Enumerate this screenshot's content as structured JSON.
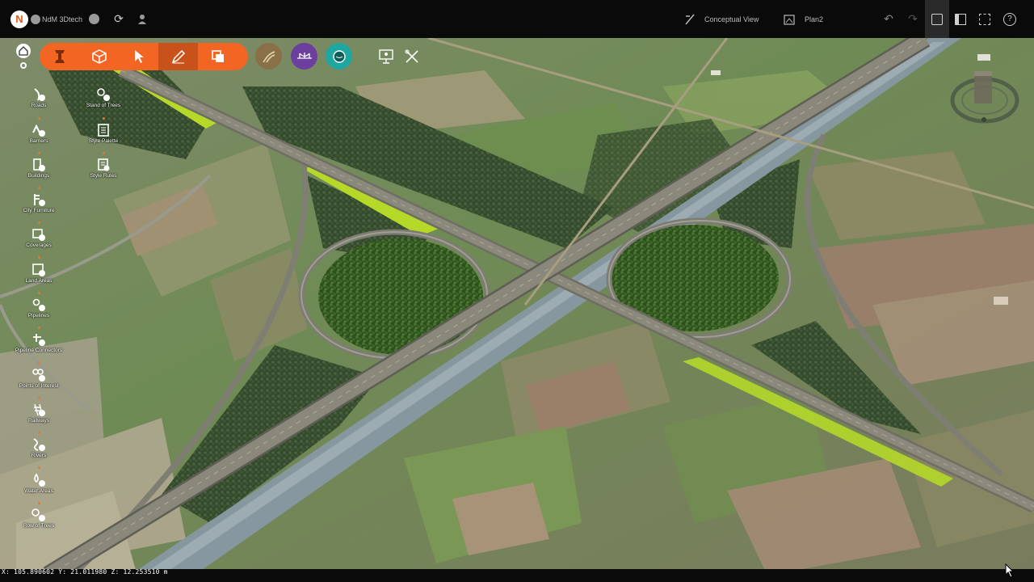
{
  "app": {
    "logo_letter": "N",
    "project_name": "NdM 3Dtech"
  },
  "topbar": {
    "view_mode": "Conceptual View",
    "plan_name": "Plan2",
    "icons": [
      "status-icon",
      "sync-icon",
      "user-icon",
      "view-icon",
      "plan-icon",
      "undo-icon",
      "redo-icon",
      "screenshot-icon",
      "panel-icon",
      "fullscreen-icon",
      "help-icon"
    ]
  },
  "toolbar": {
    "orange_tools": [
      "road-tool-icon",
      "cube-tool-icon",
      "select-tool-icon",
      "draw-tool-icon",
      "layers-tool-icon"
    ],
    "active_tool": "draw-tool-icon",
    "circle_tools": [
      {
        "name": "terrain-tool",
        "color": "#8a7048"
      },
      {
        "name": "bridge-tool",
        "color": "#6c3e9e"
      },
      {
        "name": "water-tool",
        "color": "#1da7a0"
      }
    ],
    "extra_tools": [
      "presentation-icon",
      "tools-icon"
    ]
  },
  "sidebar": {
    "left": [
      {
        "label": "Roads",
        "icon": "roads-icon"
      },
      {
        "label": "Barriers",
        "icon": "barriers-icon"
      },
      {
        "label": "Buildings",
        "icon": "buildings-icon"
      },
      {
        "label": "City Furniture",
        "icon": "city-furniture-icon"
      },
      {
        "label": "Coverages",
        "icon": "coverages-icon"
      },
      {
        "label": "Land Areas",
        "icon": "land-areas-icon"
      },
      {
        "label": "Pipelines",
        "icon": "pipelines-icon"
      },
      {
        "label": "Pipeline Connectors",
        "icon": "pipeline-connectors-icon"
      },
      {
        "label": "Points of Interest",
        "icon": "points-of-interest-icon"
      },
      {
        "label": "Railways",
        "icon": "railways-icon"
      },
      {
        "label": "Rivers",
        "icon": "rivers-icon"
      },
      {
        "label": "Water Areas",
        "icon": "water-areas-icon"
      },
      {
        "label": "Row of Trees",
        "icon": "row-of-trees-icon"
      }
    ],
    "right": [
      {
        "label": "Stand of Trees",
        "icon": "stand-of-trees-icon"
      },
      {
        "label": "Style Palette",
        "icon": "style-palette-icon"
      },
      {
        "label": "Style Rules",
        "icon": "style-rules-icon"
      }
    ]
  },
  "status": {
    "coordinates": "X: 105.890602 Y: 21.011980 Z: 12.253510 m"
  },
  "colors": {
    "accent": "#f26522",
    "field_green": "#6f8f55",
    "highlight": "#b5d829"
  }
}
